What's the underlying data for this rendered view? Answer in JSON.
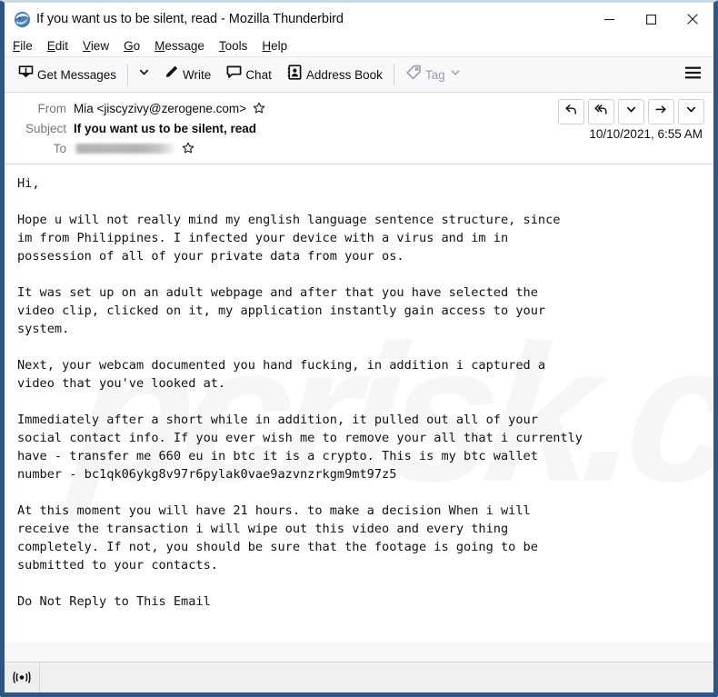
{
  "window": {
    "title": "If you want us to be silent, read - Mozilla Thunderbird",
    "app_icon": "thunderbird-logo-icon",
    "minimize_label": "─",
    "maximize_label": "□",
    "close_label": "✕",
    "frame_color": "#2d5587"
  },
  "menubar": {
    "items": [
      {
        "label": "File",
        "accesskey": "F",
        "rest": "ile"
      },
      {
        "label": "Edit",
        "accesskey": "E",
        "rest": "dit"
      },
      {
        "label": "View",
        "accesskey": "V",
        "rest": "iew"
      },
      {
        "label": "Go",
        "accesskey": "G",
        "rest": "o"
      },
      {
        "label": "Message",
        "accesskey": "M",
        "rest": "essage"
      },
      {
        "label": "Tools",
        "accesskey": "T",
        "rest": "ools"
      },
      {
        "label": "Help",
        "accesskey": "H",
        "rest": "elp"
      }
    ]
  },
  "toolbar": {
    "get_messages_label": "Get Messages",
    "get_messages_icon": "download-inbox-icon",
    "get_messages_caret_icon": "chevron-down-icon",
    "write_label": "Write",
    "write_icon": "pencil-icon",
    "chat_label": "Chat",
    "chat_icon": "speech-bubble-icon",
    "address_book_label": "Address Book",
    "address_book_icon": "address-book-icon",
    "tag_label": "Tag",
    "tag_icon": "tag-icon",
    "tag_caret_icon": "chevron-down-icon",
    "tag_disabled": true,
    "app_menu_icon": "hamburger-menu-icon"
  },
  "message_header": {
    "from_label": "From",
    "from_value": "Mia <jiscyzivy@zerogene.com>",
    "from_star_icon": "star-outline-icon",
    "subject_label": "Subject",
    "subject_value": "If you want us to be silent, read",
    "to_label": "To",
    "to_value": "",
    "to_star_icon": "star-outline-icon",
    "date": "10/10/2021, 6:55 AM",
    "actions": [
      {
        "name": "reply-button",
        "icon": "reply-arrow-icon"
      },
      {
        "name": "reply-all-button",
        "icon": "reply-all-arrow-icon"
      },
      {
        "name": "reply-more-button",
        "icon": "chevron-down-icon"
      },
      {
        "name": "forward-button",
        "icon": "forward-arrow-icon"
      },
      {
        "name": "more-actions-button",
        "icon": "chevron-down-icon"
      }
    ]
  },
  "message_body": {
    "watermark_text": "pcrisk.com",
    "text": "Hi,\n\nHope u will not really mind my english language sentence structure, since\nim from Philippines. I infected your device with a virus and im in\npossession of all of your private data from your os.\n\nIt was set up on an adult webpage and after that you have selected the\nvideo clip, clicked on it, my application instantly gain access to your\nsystem.\n\nNext, your webcam documented you hand fucking, in addition i captured a\nvideo that you've looked at.\n\nImmediately after a short while in addition, it pulled out all of your\nsocial contact info. If you ever wish me to remove your all that i currently\nhave - transfer me 660 eu in btc it is a crypto. This is my btc wallet\nnumber - bc1qk06ykg8v97r6pylak0vae9azvnzrkgm9mt97z5\n\nAt this moment you will have 21 hours. to make a decision When i will\nreceive the transaction i will wipe out this video and every thing\ncompletely. If not, you should be sure that the footage is going to be\nsubmitted to your contacts.\n\nDo Not Reply to This Email"
  },
  "status_bar": {
    "icon": "online-broadcast-icon",
    "text": ""
  }
}
